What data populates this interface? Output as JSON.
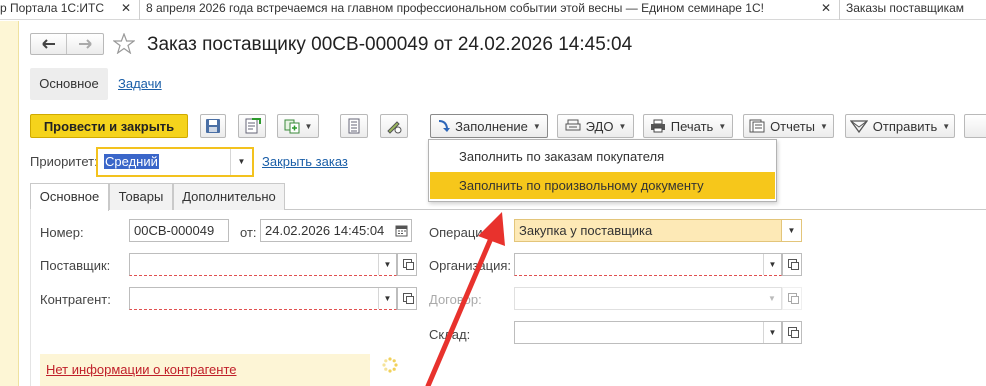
{
  "window_tabs": [
    {
      "label": "р Портала 1С:ИТС"
    },
    {
      "label": "8 апреля 2026 года встречаемся на главном профессиональном событии этой весны — Едином семинаре 1С!"
    },
    {
      "label": "Заказы поставщикам"
    }
  ],
  "header": {
    "title": "Заказ поставщику 00СВ-000049 от 24.02.2026 14:45:04"
  },
  "nav_panel": {
    "items": [
      {
        "label": "Основное"
      },
      {
        "label": "Задачи"
      }
    ]
  },
  "toolbar": {
    "post_close_label": "Провести и закрыть",
    "fill_label": "Заполнение",
    "edo_label": "ЭДО",
    "print_label": "Печать",
    "reports_label": "Отчеты",
    "send_label": "Отправить"
  },
  "fill_menu": {
    "items": [
      {
        "label": "Заполнить по заказам покупателя"
      },
      {
        "label": "Заполнить по произвольному документу"
      }
    ]
  },
  "priority": {
    "label": "Приоритет:",
    "value": "Средний",
    "close_order_label": "Закрыть заказ"
  },
  "form_tabs": [
    {
      "label": "Основное"
    },
    {
      "label": "Товары"
    },
    {
      "label": "Дополнительно"
    }
  ],
  "form": {
    "number_label": "Номер:",
    "number_value": "00СВ-000049",
    "date_label": "от:",
    "date_value": "24.02.2026 14:45:04",
    "supplier_label": "Поставщик:",
    "supplier_value": "",
    "counterparty_label": "Контрагент:",
    "counterparty_value": "",
    "operation_label": "Операция:",
    "operation_value": "Закупка у поставщика",
    "organization_label": "Организация:",
    "organization_value": "",
    "contract_label": "Договор:",
    "contract_value": "",
    "warehouse_label": "Склад:",
    "warehouse_value": ""
  },
  "info": {
    "no_counterparty_info": "Нет информации о контрагенте"
  },
  "colors": {
    "accent_yellow": "#f5d31c",
    "menu_highlight": "#f6c71b",
    "arrow_red": "#e8322d",
    "link_blue": "#1b5fa8"
  }
}
